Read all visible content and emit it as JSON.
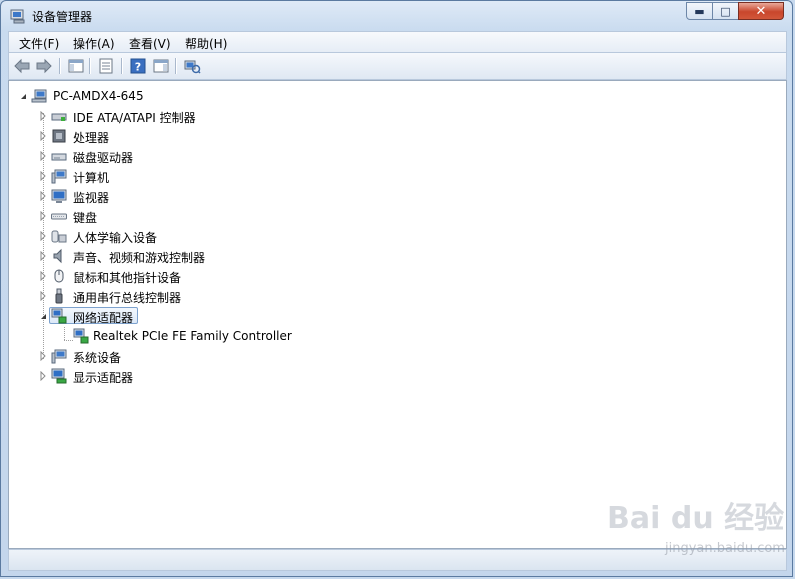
{
  "window": {
    "title": "设备管理器"
  },
  "titlebar_buttons": {
    "minimize": "▬",
    "maximize": "□",
    "close": "✕"
  },
  "menu": [
    {
      "label": "文件(F)"
    },
    {
      "label": "操作(A)"
    },
    {
      "label": "查看(V)"
    },
    {
      "label": "帮助(H)"
    }
  ],
  "toolbar": [
    {
      "name": "back-arrow-icon"
    },
    {
      "name": "forward-arrow-icon"
    },
    {
      "name": "show-hide-console-tree-icon"
    },
    {
      "name": "properties-icon"
    },
    {
      "name": "help-icon"
    },
    {
      "name": "show-action-pane-icon"
    },
    {
      "name": "scan-hardware-changes-icon"
    }
  ],
  "tree": {
    "root": {
      "label": "PC-AMDX4-645",
      "icon": "computer-icon"
    },
    "categories": [
      {
        "label": "IDE ATA/ATAPI 控制器",
        "icon": "ide-controller-icon"
      },
      {
        "label": "处理器",
        "icon": "processor-icon"
      },
      {
        "label": "磁盘驱动器",
        "icon": "disk-drive-icon"
      },
      {
        "label": "计算机",
        "icon": "computer-icon"
      },
      {
        "label": "监视器",
        "icon": "monitor-icon"
      },
      {
        "label": "键盘",
        "icon": "keyboard-icon"
      },
      {
        "label": "人体学输入设备",
        "icon": "hid-icon"
      },
      {
        "label": "声音、视频和游戏控制器",
        "icon": "speaker-icon"
      },
      {
        "label": "鼠标和其他指针设备",
        "icon": "mouse-icon"
      },
      {
        "label": "通用串行总线控制器",
        "icon": "usb-icon"
      },
      {
        "label": "网络适配器",
        "icon": "network-adapter-icon"
      },
      {
        "label": "系统设备",
        "icon": "system-device-icon"
      },
      {
        "label": "显示适配器",
        "icon": "display-adapter-icon"
      }
    ],
    "network_child": {
      "label": "Realtek PCIe FE Family Controller",
      "icon": "network-adapter-icon"
    }
  },
  "watermark": {
    "text": "Bai du 经验",
    "sub": "jingyan.baidu.com"
  },
  "colors": {
    "selection_border": "#7da2ce",
    "close_button": "#c9462c",
    "frame": "#c4d6ec"
  }
}
